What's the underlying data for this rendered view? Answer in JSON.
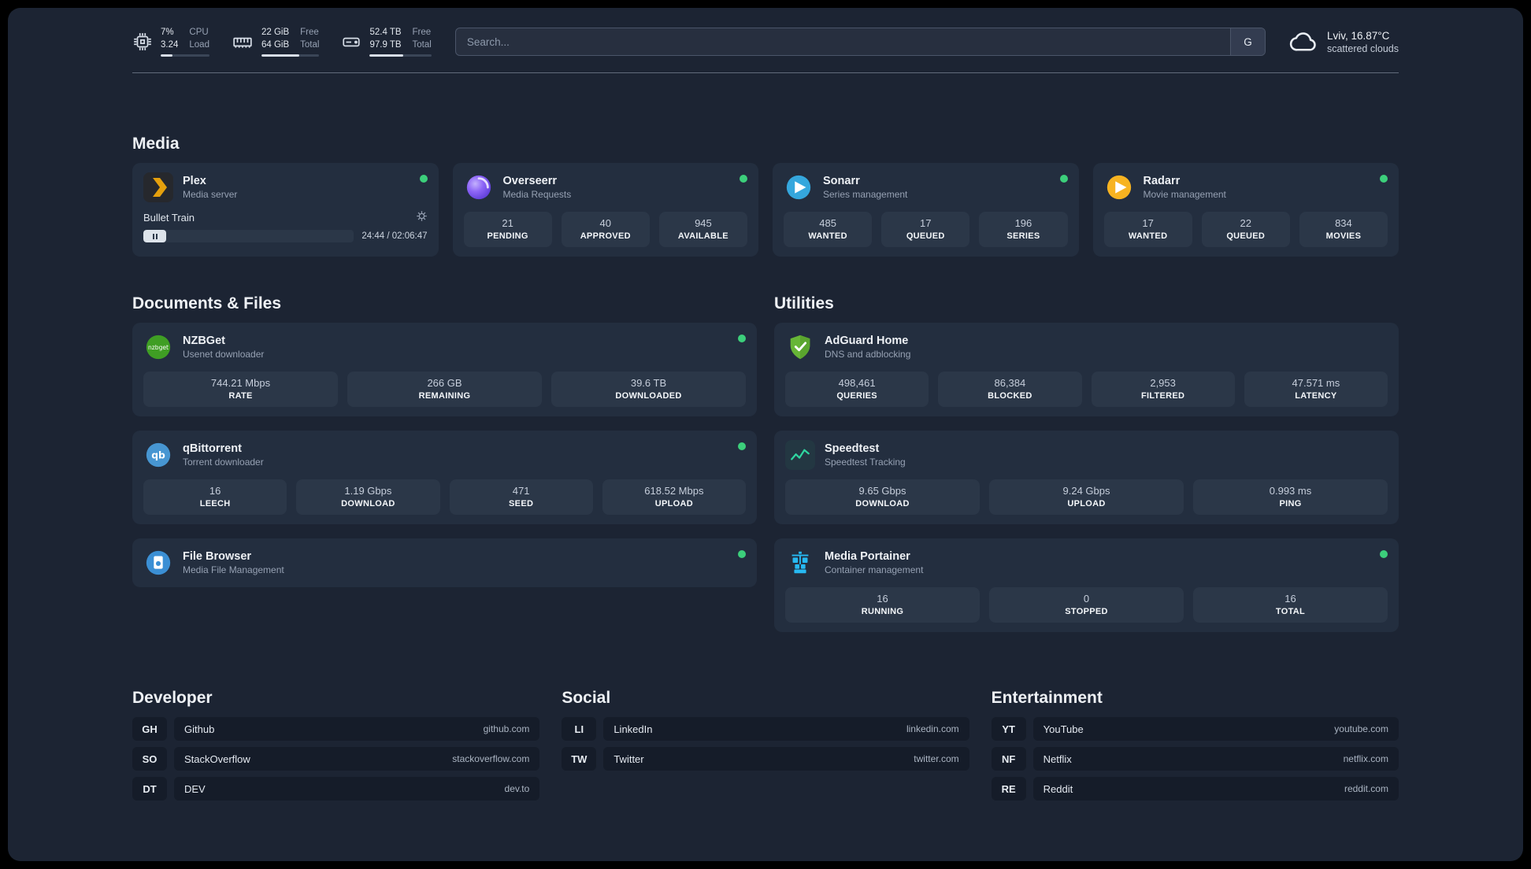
{
  "header": {
    "cpu": {
      "icon": "cpu-icon",
      "value_top": "7%",
      "value_bottom": "3.24",
      "label_top": "CPU",
      "label_bottom": "Load"
    },
    "ram": {
      "icon": "ram-icon",
      "value_top": "22 GiB",
      "value_bottom": "64 GiB",
      "label_top": "Free",
      "label_bottom": "Total"
    },
    "disk": {
      "icon": "disk-icon",
      "value_top": "52.4 TB",
      "value_bottom": "97.9 TB",
      "label_top": "Free",
      "label_bottom": "Total"
    },
    "search": {
      "placeholder": "Search...",
      "engine_label": "G"
    },
    "weather": {
      "icon": "cloud-icon",
      "location": "Lviv, 16.87°C",
      "condition": "scattered clouds"
    }
  },
  "sections": {
    "media": {
      "title": "Media",
      "apps": [
        {
          "name": "Plex",
          "desc": "Media server",
          "icon": "plex-icon",
          "online": true,
          "player": {
            "track": "Bullet Train",
            "time": "24:44 / 02:06:47"
          }
        },
        {
          "name": "Overseerr",
          "desc": "Media Requests",
          "icon": "overseerr-icon",
          "online": true,
          "stats": [
            {
              "value": "21",
              "label": "PENDING"
            },
            {
              "value": "40",
              "label": "APPROVED"
            },
            {
              "value": "945",
              "label": "AVAILABLE"
            }
          ]
        },
        {
          "name": "Sonarr",
          "desc": "Series management",
          "icon": "sonarr-icon",
          "online": true,
          "stats": [
            {
              "value": "485",
              "label": "WANTED"
            },
            {
              "value": "17",
              "label": "QUEUED"
            },
            {
              "value": "196",
              "label": "SERIES"
            }
          ]
        },
        {
          "name": "Radarr",
          "desc": "Movie management",
          "icon": "radarr-icon",
          "online": true,
          "stats": [
            {
              "value": "17",
              "label": "WANTED"
            },
            {
              "value": "22",
              "label": "QUEUED"
            },
            {
              "value": "834",
              "label": "MOVIES"
            }
          ]
        }
      ]
    },
    "documents": {
      "title": "Documents & Files",
      "apps": [
        {
          "name": "NZBGet",
          "desc": "Usenet downloader",
          "icon": "nzbget-icon",
          "online": true,
          "stats": [
            {
              "value": "744.21 Mbps",
              "label": "RATE"
            },
            {
              "value": "266 GB",
              "label": "REMAINING"
            },
            {
              "value": "39.6 TB",
              "label": "DOWNLOADED"
            }
          ]
        },
        {
          "name": "qBittorrent",
          "desc": "Torrent downloader",
          "icon": "qbittorrent-icon",
          "online": true,
          "stats": [
            {
              "value": "16",
              "label": "LEECH"
            },
            {
              "value": "1.19 Gbps",
              "label": "DOWNLOAD"
            },
            {
              "value": "471",
              "label": "SEED"
            },
            {
              "value": "618.52 Mbps",
              "label": "UPLOAD"
            }
          ]
        },
        {
          "name": "File Browser",
          "desc": "Media File Management",
          "icon": "filebrowser-icon",
          "online": true,
          "stats": []
        }
      ]
    },
    "utilities": {
      "title": "Utilities",
      "apps": [
        {
          "name": "AdGuard Home",
          "desc": "DNS and adblocking",
          "icon": "adguard-icon",
          "online": false,
          "stats": [
            {
              "value": "498,461",
              "label": "QUERIES"
            },
            {
              "value": "86,384",
              "label": "BLOCKED"
            },
            {
              "value": "2,953",
              "label": "FILTERED"
            },
            {
              "value": "47.571 ms",
              "label": "LATENCY"
            }
          ]
        },
        {
          "name": "Speedtest",
          "desc": "Speedtest Tracking",
          "icon": "speedtest-icon",
          "online": false,
          "stats": [
            {
              "value": "9.65 Gbps",
              "label": "DOWNLOAD"
            },
            {
              "value": "9.24 Gbps",
              "label": "UPLOAD"
            },
            {
              "value": "0.993 ms",
              "label": "PING"
            }
          ]
        },
        {
          "name": "Media Portainer",
          "desc": "Container management",
          "icon": "portainer-icon",
          "online": true,
          "stats": [
            {
              "value": "16",
              "label": "RUNNING"
            },
            {
              "value": "0",
              "label": "STOPPED"
            },
            {
              "value": "16",
              "label": "TOTAL"
            }
          ]
        }
      ]
    }
  },
  "bookmarks": [
    {
      "title": "Developer",
      "items": [
        {
          "abbr": "GH",
          "name": "Github",
          "url": "github.com"
        },
        {
          "abbr": "SO",
          "name": "StackOverflow",
          "url": "stackoverflow.com"
        },
        {
          "abbr": "DT",
          "name": "DEV",
          "url": "dev.to"
        }
      ]
    },
    {
      "title": "Social",
      "items": [
        {
          "abbr": "LI",
          "name": "LinkedIn",
          "url": "linkedin.com"
        },
        {
          "abbr": "TW",
          "name": "Twitter",
          "url": "twitter.com"
        }
      ]
    },
    {
      "title": "Entertainment",
      "items": [
        {
          "abbr": "YT",
          "name": "YouTube",
          "url": "youtube.com"
        },
        {
          "abbr": "NF",
          "name": "Netflix",
          "url": "netflix.com"
        },
        {
          "abbr": "RE",
          "name": "Reddit",
          "url": "reddit.com"
        }
      ]
    }
  ],
  "colors": {
    "background": "#1c2433",
    "card": "#232e3f",
    "stat_tile": "#2b3748",
    "status_online": "#3ccf7b",
    "plex_orange": "#e5a00d",
    "adguard_green": "#67b637",
    "portainer_blue": "#27b9f2"
  }
}
